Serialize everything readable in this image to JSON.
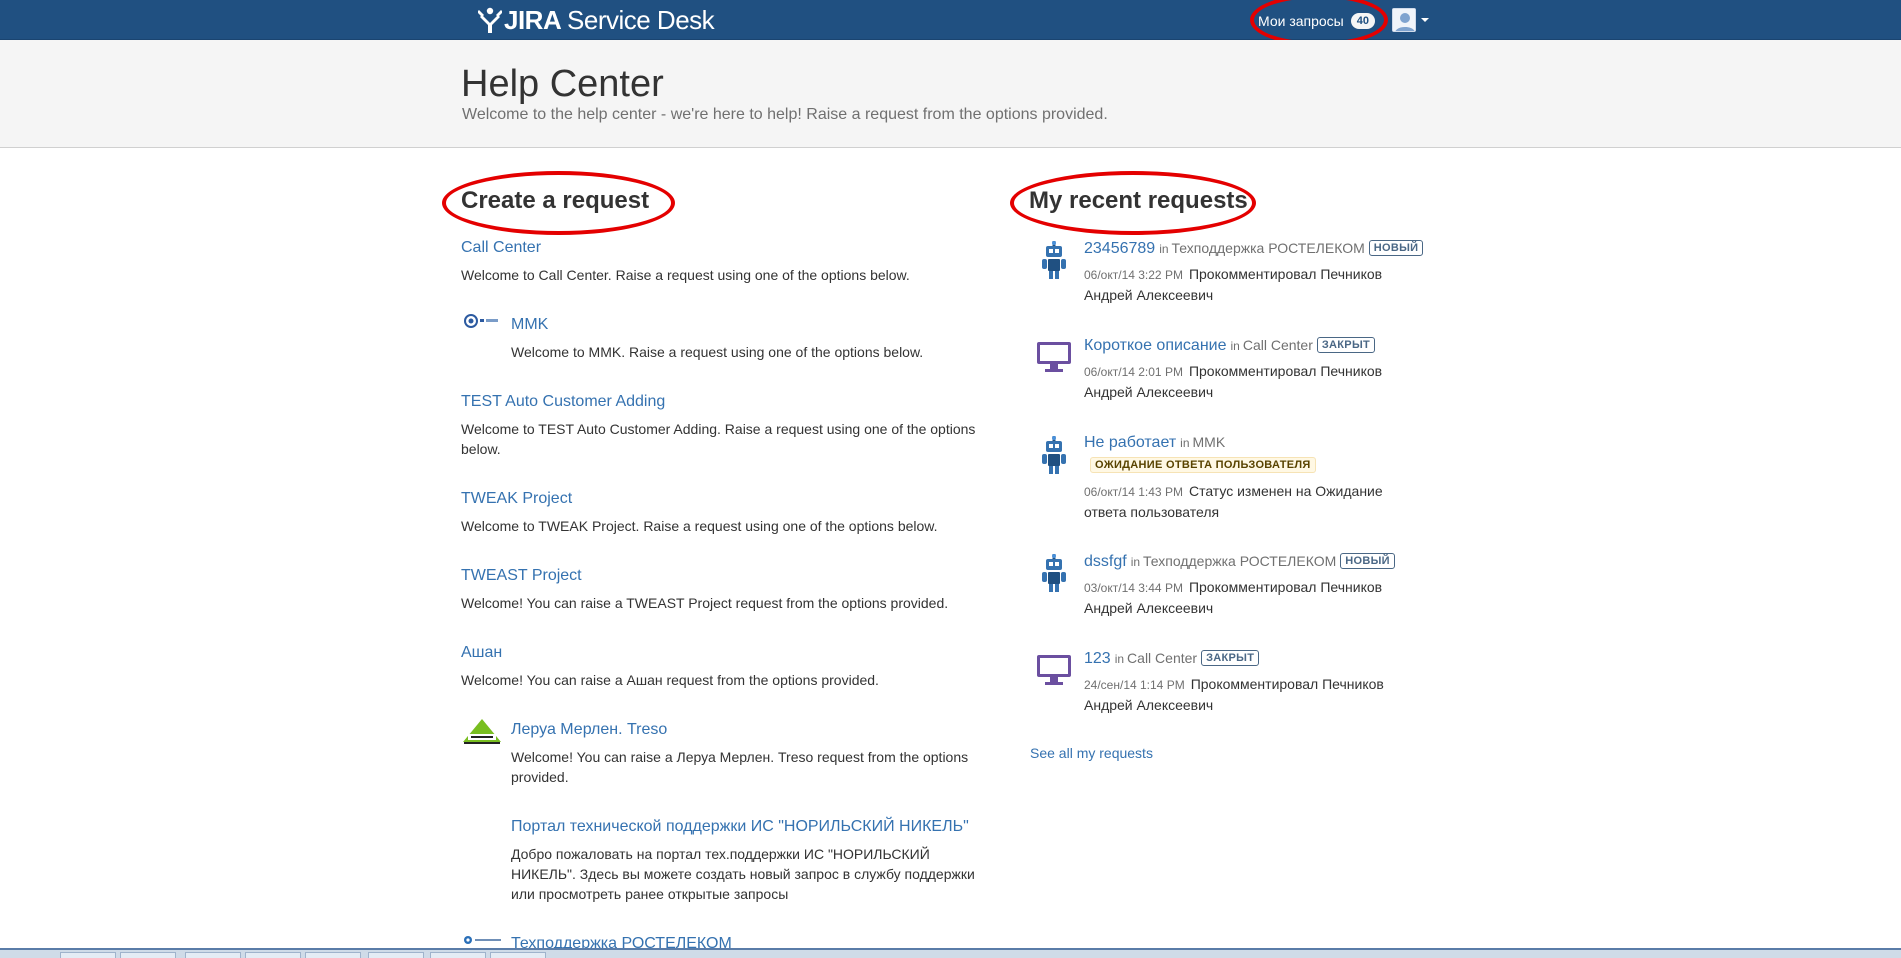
{
  "topbar": {
    "logo_text_bold": "JIRA",
    "logo_text_light": "Service Desk",
    "my_requests_label": "Мои запросы",
    "my_requests_count": "40"
  },
  "header": {
    "title": "Help Center",
    "subtitle": "Welcome to the help center - we're here to help! Raise a request from the options provided."
  },
  "create": {
    "title": "Create a request",
    "portals": [
      {
        "name": "Call Center",
        "desc": "Welcome to Call Center. Raise a request using one of the options below.",
        "logo": "none"
      },
      {
        "name": "MMK",
        "desc": "Welcome to MMK. Raise a request using one of the options below.",
        "logo": "mmk-logo"
      },
      {
        "name": "TEST Auto Customer Adding",
        "desc": "Welcome to TEST Auto Customer Adding. Raise a request using one of the options below.",
        "logo": "none"
      },
      {
        "name": "TWEAK Project",
        "desc": "Welcome to TWEAK Project. Raise a request using one of the options below.",
        "logo": "none"
      },
      {
        "name": "TWEAST Project",
        "desc": "Welcome! You can raise a TWEAST Project request from the options provided.",
        "logo": "none"
      },
      {
        "name": "Ашан",
        "desc": "Welcome! You can raise a Ашан request from the options provided.",
        "logo": "none"
      },
      {
        "name": "Леруа Мерлен. Treso",
        "desc": "Welcome! You can raise a Леруа Мерлен. Treso request from the options provided.",
        "logo": "leroy-merlin-logo"
      },
      {
        "name": "Портал технической поддержки ИС \"НОРИЛЬСКИЙ НИКЕЛЬ\"",
        "desc": "Добро пожаловать на портал тех.поддержки ИС \"НОРИЛЬСКИЙ НИКЕЛЬ\". Здесь вы можете создать новый запрос в службу поддержки или просмотреть ранее открытые запросы",
        "logo": "blank"
      },
      {
        "name": "Техподдержка РОСТЕЛЕКОМ",
        "desc": "",
        "logo": "rostelecom-logo"
      }
    ]
  },
  "recent": {
    "title": "My recent requests",
    "in_word": "in",
    "items": [
      {
        "summary": "23456789",
        "project": "Техподдержка РОСТЕЛЕКОМ",
        "status": "НОВЫЙ",
        "status_color": "blue",
        "time": "06/окт/14 3:22 PM",
        "activity": "Прокомментировал Печников Андрей Алексеевич",
        "icon": "robot-icon"
      },
      {
        "summary": "Короткое описание",
        "project": "Call Center",
        "status": "ЗАКРЫТ",
        "status_color": "blue",
        "time": "06/окт/14 2:01 PM",
        "activity": "Прокомментировал Печников Андрей Алексеевич",
        "icon": "monitor-icon"
      },
      {
        "summary": "Не работает",
        "project": "MMK",
        "status": "ОЖИДАНИЕ ОТВЕТА ПОЛЬЗОВАТЕЛЯ",
        "status_color": "yellow",
        "time": "06/окт/14 1:43 PM",
        "activity": "Статус изменен на Ожидание ответа пользователя",
        "icon": "robot-icon"
      },
      {
        "summary": "dssfgf",
        "project": "Техподдержка РОСТЕЛЕКОМ",
        "status": "НОВЫЙ",
        "status_color": "blue",
        "time": "03/окт/14 3:44 PM",
        "activity": "Прокомментировал Печников Андрей Алексеевич",
        "icon": "robot-icon"
      },
      {
        "summary": "123",
        "project": "Call Center",
        "status": "ЗАКРЫТ",
        "status_color": "blue",
        "time": "24/сен/14 1:14 PM",
        "activity": "Прокомментировал Печников Андрей Алексеевич",
        "icon": "monitor-icon"
      }
    ],
    "see_all_label": "See all my requests"
  },
  "colors": {
    "topbar": "#205081",
    "link": "#3572b0",
    "annotation": "#e40000"
  }
}
